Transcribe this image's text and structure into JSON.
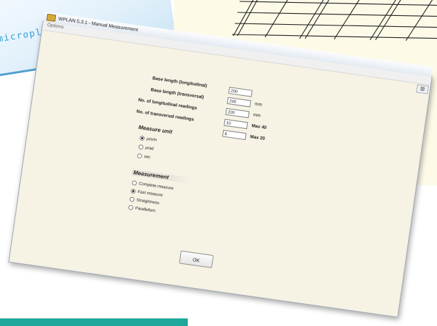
{
  "background": {
    "brand_text": "micropla"
  },
  "window": {
    "title": "WPLAN 5.3.1 - Manual Measurement",
    "close_glyph": "⊠",
    "menu": {
      "options": "Options"
    }
  },
  "form": {
    "base_length_longitudinal": {
      "label": "Base length (longitudinal)",
      "value": "200",
      "unit": ""
    },
    "base_length_transversal": {
      "label": "Base length (transversal)",
      "value": "200",
      "unit": "mm"
    },
    "longitudinal_readings": {
      "label": "No. of longitudinal readings",
      "value": "200",
      "unit": "mm"
    },
    "transversal_readings": {
      "label": "No. of transversal readings",
      "value": "10",
      "unit": "Max 40"
    },
    "extra_field": {
      "value": "6",
      "unit": "Max 20"
    }
  },
  "measure_unit": {
    "title": "Measure unit",
    "options": [
      {
        "label": "µm/m",
        "checked": true
      },
      {
        "label": "µrad",
        "checked": false
      },
      {
        "label": "sec",
        "checked": false
      }
    ]
  },
  "measurement": {
    "title": "Measurement",
    "options": [
      {
        "label": "Complete measure",
        "checked": false
      },
      {
        "label": "Fast measure",
        "checked": true
      },
      {
        "label": "Straightness",
        "checked": false
      },
      {
        "label": "Parallelism",
        "checked": false
      }
    ]
  },
  "buttons": {
    "ok": "OK"
  },
  "colors": {
    "window_bg": "#f6f2e4",
    "brand_blue": "#2b9fd8",
    "teal": "#1da89a",
    "grid_bg": "#fdfae8"
  }
}
